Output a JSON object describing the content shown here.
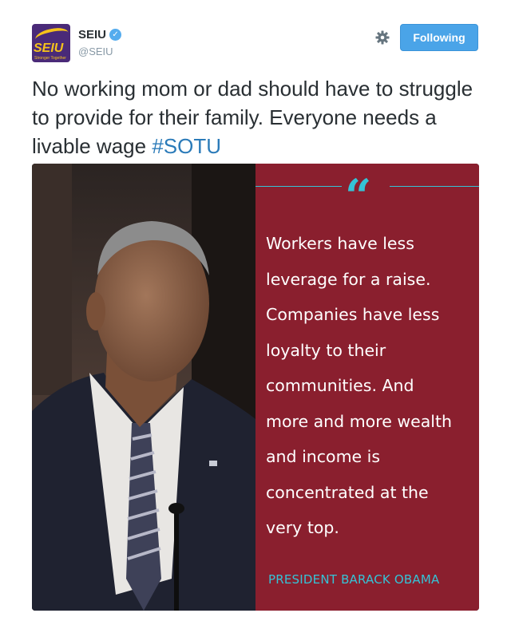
{
  "account": {
    "display_name": "SEIU",
    "handle": "@SEIU",
    "verified": true,
    "avatar_text": "SEIU",
    "avatar_subtext": "Stronger Together"
  },
  "actions": {
    "follow_label": "Following"
  },
  "tweet": {
    "text": "No working mom or dad should have to struggle to provide for their family. Everyone needs a livable wage",
    "hashtag": "#SOTU"
  },
  "media": {
    "quote_mark": "“",
    "quote_lines": [
      "Workers have less",
      "leverage for a raise.",
      "Companies have less",
      "loyalty to their",
      "communities. And",
      "more and more wealth",
      "and income is",
      "concentrated at the",
      "very top."
    ],
    "attribution": "PRESIDENT BARACK OBAMA"
  },
  "colors": {
    "follow_button": "#4aa4e8",
    "hashtag": "#2b7bb9",
    "quote_panel": "#8a1f2e",
    "quote_accent": "#35c3d6",
    "avatar_bg": "#4a2a78",
    "avatar_gold": "#f5c21b"
  },
  "icons": {
    "verified": "verified-badge-icon",
    "settings": "gear-icon"
  }
}
